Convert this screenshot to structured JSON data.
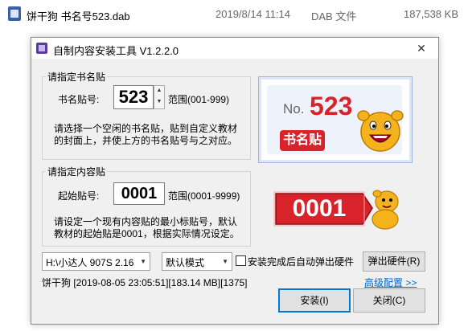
{
  "file": {
    "name": "饼干狗 书名号523.dab",
    "date": "2019/8/14 11:14",
    "type": "DAB 文件",
    "size": "187,538 KB"
  },
  "window": {
    "title": "自制内容安装工具 V1.2.2.0",
    "close_glyph": "✕"
  },
  "book_group": {
    "legend": "请指定书名贴",
    "field_label": "书名贴号:",
    "value": "523",
    "range": "范围(001-999)",
    "desc_line1": "请选择一个空闲的书名贴，贴到自定义教材",
    "desc_line2": "的封面上，并使上方的书名贴号与之对应。"
  },
  "content_group": {
    "legend": "请指定内容贴",
    "field_label": "起始贴号:",
    "value": "0001",
    "range": "范围(0001-9999)",
    "desc_line1": "请设定一个现有内容贴的最小标贴号，默认",
    "desc_line2": "教材的起始贴是0001，根据实际情况设定。"
  },
  "illustration1": {
    "prefix": "No.",
    "number": "523",
    "caption": "书名贴"
  },
  "illustration2": {
    "number": "0001"
  },
  "bottom": {
    "drive_value": "H:\\小达人 907S 2.16",
    "mode_value": "默认模式",
    "checkbox_label": "安装完成后自动弹出硬件",
    "eject_button": "弹出硬件(R)",
    "status": "饼干狗 [2019-08-05 23:05:51][183.14 MB][1375]",
    "advanced_link": "高级配置 >>",
    "install_button": "安装(I)",
    "close_button": "关闭(C)"
  },
  "colors": {
    "accent_blue": "#0078d7",
    "sticker_red": "#d8232a",
    "link_blue": "#0066cc",
    "dog_yellow": "#f4b31c"
  }
}
